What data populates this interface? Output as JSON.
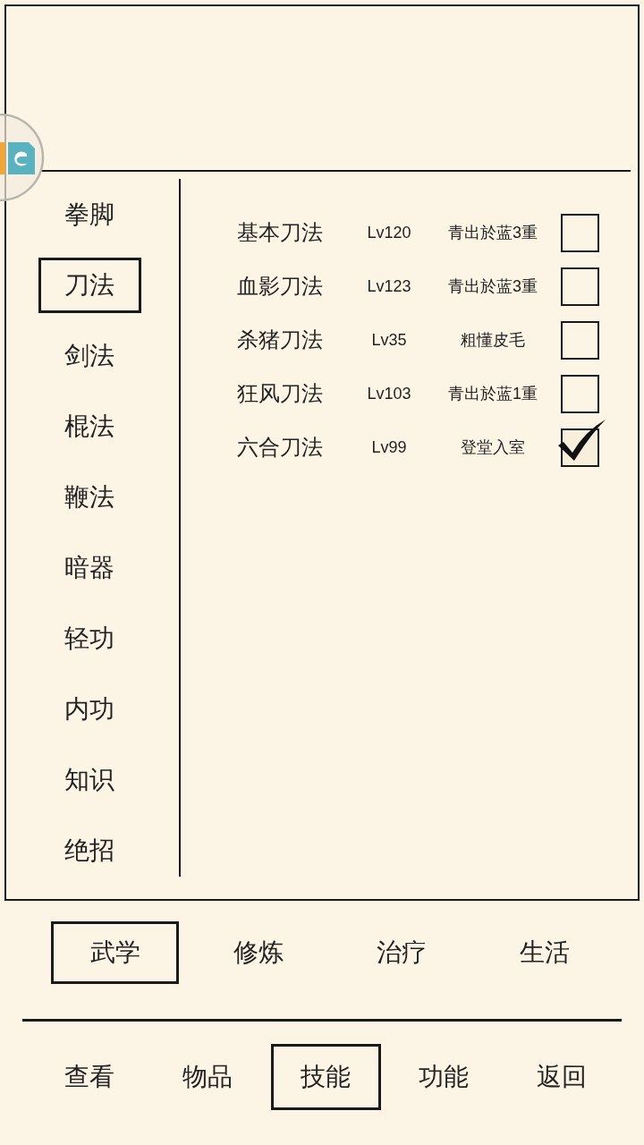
{
  "sidebar": {
    "items": [
      {
        "label": "拳脚",
        "selected": false
      },
      {
        "label": "刀法",
        "selected": true
      },
      {
        "label": "剑法",
        "selected": false
      },
      {
        "label": "棍法",
        "selected": false
      },
      {
        "label": "鞭法",
        "selected": false
      },
      {
        "label": "暗器",
        "selected": false
      },
      {
        "label": "轻功",
        "selected": false
      },
      {
        "label": "内功",
        "selected": false
      },
      {
        "label": "知识",
        "selected": false
      },
      {
        "label": "绝招",
        "selected": false
      }
    ]
  },
  "skills": [
    {
      "name": "基本刀法",
      "lv": "Lv120",
      "rank": "青出於蓝3重",
      "checked": false
    },
    {
      "name": "血影刀法",
      "lv": "Lv123",
      "rank": "青出於蓝3重",
      "checked": false
    },
    {
      "name": "杀猪刀法",
      "lv": "Lv35",
      "rank": "粗懂皮毛",
      "checked": false
    },
    {
      "name": "狂风刀法",
      "lv": "Lv103",
      "rank": "青出於蓝1重",
      "checked": false
    },
    {
      "name": "六合刀法",
      "lv": "Lv99",
      "rank": "登堂入室",
      "checked": true
    }
  ],
  "categories": [
    {
      "label": "武学",
      "selected": true
    },
    {
      "label": "修炼",
      "selected": false
    },
    {
      "label": "治疗",
      "selected": false
    },
    {
      "label": "生活",
      "selected": false
    }
  ],
  "nav": [
    {
      "label": "查看",
      "selected": false
    },
    {
      "label": "物品",
      "selected": false
    },
    {
      "label": "技能",
      "selected": true
    },
    {
      "label": "功能",
      "selected": false
    },
    {
      "label": "返回",
      "selected": false
    }
  ]
}
